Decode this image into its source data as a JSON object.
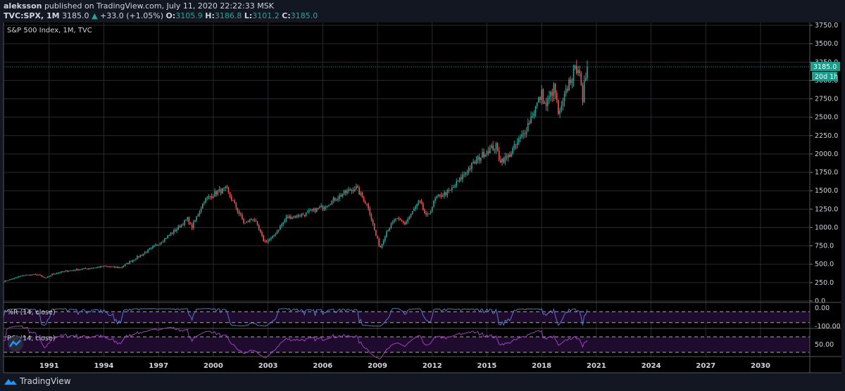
{
  "header": {
    "author": "aleksson",
    "published": "published on TradingView.com, July 11, 2020 22:22:33 MSK",
    "symbol": "TVC:SPX, 1M",
    "last": "3185.0",
    "change": "+33.0 (+1.05%)",
    "o_label": "O:",
    "o": "3105.9",
    "h_label": "H:",
    "h": "3186.8",
    "l_label": "L:",
    "l": "3101.2",
    "c_label": "C:",
    "c": "3185.0"
  },
  "legend": "S&P 500 Index, 1M, TVC",
  "price_badge": "3185.0",
  "countdown_badge": "20d 1h",
  "footer": {
    "brand": "TradingView"
  },
  "colors": {
    "up": "#26a69a",
    "down": "#ef5350",
    "wr": "#5b77c9",
    "rsi": "#a040c0",
    "badge": "#1e9b8a",
    "bg": "#000000",
    "grid": "#2a2a2e"
  },
  "chart_data": {
    "type": "candlestick",
    "title": "S&P 500 Index, 1M, TVC",
    "ylim": [
      0,
      3750
    ],
    "y_ticks": [
      "0.0",
      "250.0",
      "500.0",
      "750.0",
      "1000.0",
      "1250.0",
      "1500.0",
      "1750.0",
      "2000.0",
      "2250.0",
      "2500.0",
      "2750.0",
      "3000.0",
      "3250.0",
      "3500.0",
      "3750.0"
    ],
    "x_ticks": [
      "1991",
      "1994",
      "1997",
      "2000",
      "2003",
      "2006",
      "2009",
      "2012",
      "2015",
      "2018",
      "2021",
      "2024",
      "2027",
      "2030"
    ],
    "xlim": [
      1988.5,
      2032.7
    ],
    "close_anchors": [
      [
        1988.5,
        265
      ],
      [
        1989.6,
        350
      ],
      [
        1990.4,
        360
      ],
      [
        1990.8,
        305
      ],
      [
        1991.2,
        370
      ],
      [
        1992,
        410
      ],
      [
        1993,
        440
      ],
      [
        1994,
        470
      ],
      [
        1994.9,
        455
      ],
      [
        1996,
        620
      ],
      [
        1997,
        780
      ],
      [
        1998,
        980
      ],
      [
        1998.6,
        1120
      ],
      [
        1998.8,
        990
      ],
      [
        1999.5,
        1370
      ],
      [
        2000.2,
        1480
      ],
      [
        2000.7,
        1520
      ],
      [
        2001.2,
        1300
      ],
      [
        2001.7,
        1050
      ],
      [
        2002.2,
        1130
      ],
      [
        2002.8,
        800
      ],
      [
        2003.2,
        850
      ],
      [
        2004,
        1130
      ],
      [
        2005,
        1180
      ],
      [
        2006,
        1280
      ],
      [
        2007,
        1440
      ],
      [
        2007.8,
        1550
      ],
      [
        2008.5,
        1280
      ],
      [
        2008.9,
        900
      ],
      [
        2009.15,
        720
      ],
      [
        2009.5,
        950
      ],
      [
        2010,
        1120
      ],
      [
        2010.5,
        1050
      ],
      [
        2011.3,
        1360
      ],
      [
        2011.7,
        1130
      ],
      [
        2012.2,
        1400
      ],
      [
        2013,
        1500
      ],
      [
        2014,
        1800
      ],
      [
        2015,
        2050
      ],
      [
        2015.5,
        2100
      ],
      [
        2015.7,
        1920
      ],
      [
        2016.1,
        1940
      ],
      [
        2017,
        2270
      ],
      [
        2018,
        2820
      ],
      [
        2018.2,
        2640
      ],
      [
        2018.7,
        2910
      ],
      [
        2018.95,
        2500
      ],
      [
        2019.5,
        2980
      ],
      [
        2020.05,
        3230
      ],
      [
        2020.15,
        2950
      ],
      [
        2020.23,
        2580
      ],
      [
        2020.32,
        2910
      ],
      [
        2020.4,
        3050
      ],
      [
        2020.45,
        3100
      ],
      [
        2020.53,
        3185
      ]
    ],
    "last_close": 3185.0,
    "indicators": [
      {
        "name": "%R (14, close)",
        "ticks": [
          "0.00",
          "-100.00"
        ],
        "levels": [
          -20,
          -80
        ]
      },
      {
        "name": "RSI (14, close)",
        "ticks": [
          "50.00"
        ],
        "levels": [
          70,
          30
        ]
      }
    ]
  }
}
